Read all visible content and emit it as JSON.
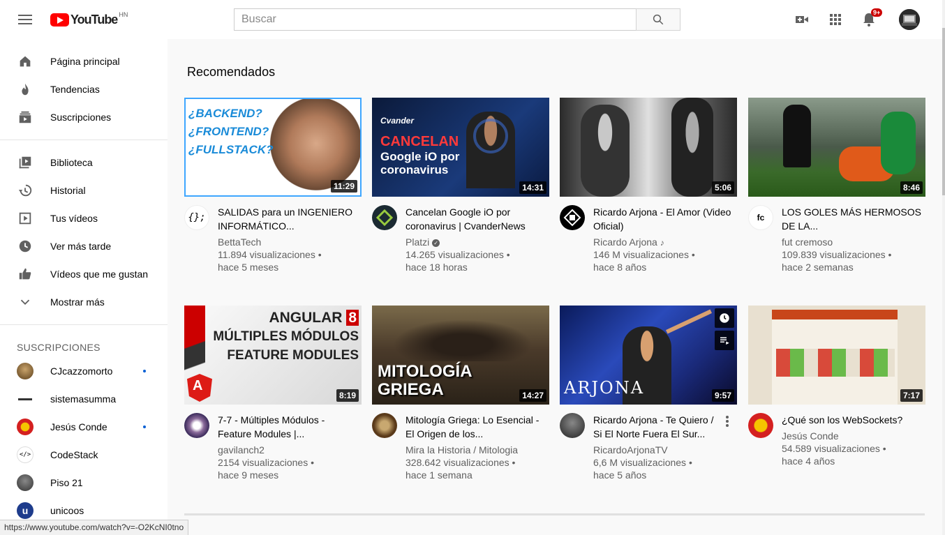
{
  "header": {
    "logo_text": "YouTube",
    "country": "HN",
    "search_placeholder": "Buscar",
    "notifications_badge": "9+"
  },
  "sidebar": {
    "main_items": [
      {
        "label": "Página principal",
        "icon": "home-icon"
      },
      {
        "label": "Tendencias",
        "icon": "trending-icon"
      },
      {
        "label": "Suscripciones",
        "icon": "subscriptions-icon"
      }
    ],
    "library_items": [
      {
        "label": "Biblioteca",
        "icon": "library-icon"
      },
      {
        "label": "Historial",
        "icon": "history-icon"
      },
      {
        "label": "Tus vídeos",
        "icon": "your-videos-icon"
      },
      {
        "label": "Ver más tarde",
        "icon": "watch-later-icon"
      },
      {
        "label": "Vídeos que me gustan",
        "icon": "like-icon"
      },
      {
        "label": "Mostrar más",
        "icon": "chevron-down-icon"
      }
    ],
    "subscriptions_heading": "SUSCRIPCIONES",
    "subscriptions": [
      {
        "name": "CJcazzomorto",
        "new": true
      },
      {
        "name": "sistemasumma",
        "new": false
      },
      {
        "name": "Jesús Conde",
        "new": true
      },
      {
        "name": "CodeStack",
        "new": false
      },
      {
        "name": "Piso 21",
        "new": false
      },
      {
        "name": "unicoos",
        "new": false
      }
    ]
  },
  "main": {
    "title": "Recomendados",
    "videos": [
      {
        "title": "SALIDAS para un INGENIERO INFORMÁTICO...",
        "channel": "BettaTech",
        "views": "11.894 visualizaciones •",
        "age": "hace 5 meses",
        "duration": "11:29",
        "thumb_text": "¿BACKEND? ¿FRONTEND? ¿FULLSTACK?",
        "verified": false
      },
      {
        "title": "Cancelan Google iO por coronavirus | CvanderNews",
        "channel": "Platzi",
        "views": "14.265 visualizaciones •",
        "age": "hace 18 horas",
        "duration": "14:31",
        "thumb_text": "CANCELAN Google iO por coronavirus",
        "thumb_brand": "Cvander NEWS",
        "verified": true
      },
      {
        "title": "Ricardo Arjona - El Amor (Video Oficial)",
        "channel": "Ricardo Arjona",
        "views": "146 M visualizaciones •",
        "age": "hace 8 años",
        "duration": "5:06",
        "verified": false,
        "music": true
      },
      {
        "title": "LOS GOLES MÁS HERMOSOS DE LA...",
        "channel": "fut cremoso",
        "views": "109.839 visualizaciones •",
        "age": "hace 2 semanas",
        "duration": "8:46",
        "verified": false
      },
      {
        "title": "7-7 - Múltiples Módulos - Feature Modules |...",
        "channel": "gavilanch2",
        "views": "2154 visualizaciones •",
        "age": "hace 9 meses",
        "duration": "8:19",
        "thumb_text_1": "ANGULAR",
        "thumb_text_num": "8",
        "thumb_text_2": "MÚLTIPLES MÓDULOS",
        "thumb_text_3": "FEATURE MODULES",
        "verified": false
      },
      {
        "title": "Mitología Griega: Lo Esencial - El Origen de los...",
        "channel": "Mira la Historia / Mitologia",
        "views": "328.642 visualizaciones •",
        "age": "hace 1 semana",
        "duration": "14:27",
        "thumb_text": "MITOLOGÍA GRIEGA",
        "verified": false
      },
      {
        "title": "Ricardo Arjona - Te Quiero / Si El Norte Fuera El Sur...",
        "channel": "RicardoArjonaTV",
        "views": "6,6 M visualizaciones •",
        "age": "hace 5 años",
        "duration": "9:57",
        "thumb_text": "ARJONA",
        "verified": false
      },
      {
        "title": "¿Qué son los WebSockets?",
        "channel": "Jesús Conde",
        "views": "54.589 visualizaciones •",
        "age": "hace 4 años",
        "duration": "7:17",
        "verified": false
      }
    ]
  },
  "status_url": "https://www.youtube.com/watch?v=-O2KcNI0tno",
  "colors": {
    "brand_red": "#ff0000",
    "link_blue": "#065fd4",
    "text_secondary": "#606060"
  }
}
